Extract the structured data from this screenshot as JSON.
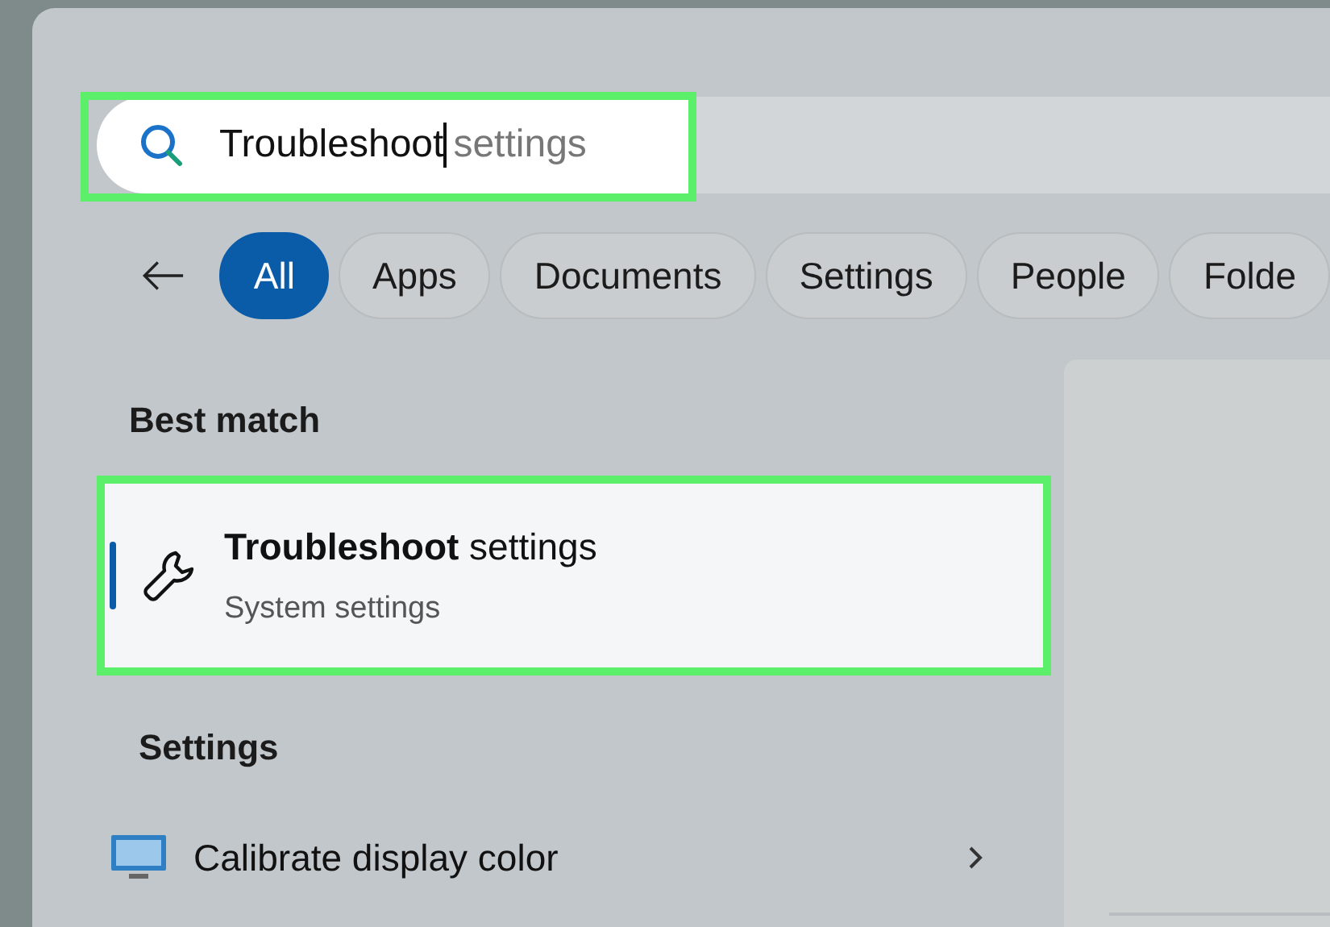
{
  "search": {
    "value": "Troubleshoot",
    "suggestion": "settings",
    "highlighted": true
  },
  "filters": [
    {
      "label": "All",
      "selected": true
    },
    {
      "label": "Apps",
      "selected": false
    },
    {
      "label": "Documents",
      "selected": false
    },
    {
      "label": "Settings",
      "selected": false
    },
    {
      "label": "People",
      "selected": false
    },
    {
      "label": "Folde",
      "selected": false
    }
  ],
  "best_match": {
    "heading": "Best match",
    "title": "**Troubleshoot** settings",
    "subtitle": "System settings",
    "selected": true,
    "highlighted": true
  },
  "settings_section": {
    "heading": "Settings",
    "items": [
      {
        "label": "Calibrate display color"
      }
    ]
  }
}
